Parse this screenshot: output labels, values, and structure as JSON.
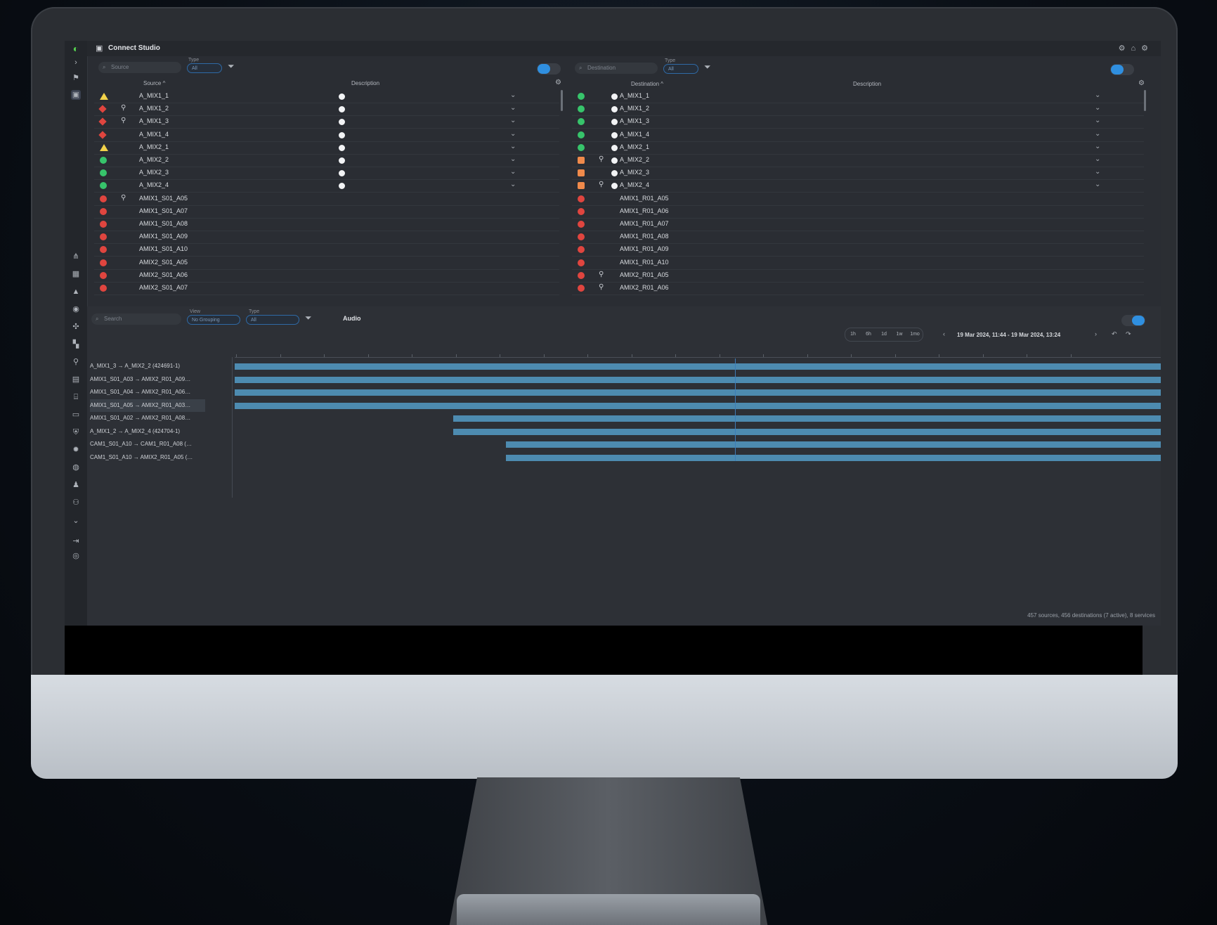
{
  "app": {
    "title": "Connect Studio"
  },
  "source_panel": {
    "search_placeholder": "Source",
    "type_label": "Type",
    "type_value": "All",
    "col_source": "Source ^",
    "col_description": "Description",
    "rows": [
      {
        "status": "warn",
        "pin": false,
        "name": "A_MIX1_1",
        "dot": true
      },
      {
        "status": "redd",
        "pin": true,
        "name": "A_MIX1_2",
        "dot": true
      },
      {
        "status": "redd",
        "pin": true,
        "name": "A_MIX1_3",
        "dot": true
      },
      {
        "status": "redd",
        "pin": false,
        "name": "A_MIX1_4",
        "dot": true
      },
      {
        "status": "warn",
        "pin": false,
        "name": "A_MIX2_1",
        "dot": true
      },
      {
        "status": "green",
        "pin": false,
        "name": "A_MIX2_2",
        "dot": true
      },
      {
        "status": "green",
        "pin": false,
        "name": "A_MIX2_3",
        "dot": true
      },
      {
        "status": "green",
        "pin": false,
        "name": "A_MIX2_4",
        "dot": true
      },
      {
        "status": "red",
        "pin": true,
        "name": "AMIX1_S01_A05",
        "dot": false
      },
      {
        "status": "red",
        "pin": false,
        "name": "AMIX1_S01_A07",
        "dot": false
      },
      {
        "status": "red",
        "pin": false,
        "name": "AMIX1_S01_A08",
        "dot": false
      },
      {
        "status": "red",
        "pin": false,
        "name": "AMIX1_S01_A09",
        "dot": false
      },
      {
        "status": "red",
        "pin": false,
        "name": "AMIX1_S01_A10",
        "dot": false
      },
      {
        "status": "red",
        "pin": false,
        "name": "AMIX2_S01_A05",
        "dot": false
      },
      {
        "status": "red",
        "pin": false,
        "name": "AMIX2_S01_A06",
        "dot": false
      },
      {
        "status": "red",
        "pin": false,
        "name": "AMIX2_S01_A07",
        "dot": false
      }
    ]
  },
  "destination_panel": {
    "search_placeholder": "Destination",
    "type_label": "Type",
    "type_value": "All",
    "col_destination": "Destination ^",
    "col_description": "Description",
    "rows": [
      {
        "status": "green",
        "pin": false,
        "name": "A_MIX1_1",
        "dot": true
      },
      {
        "status": "green",
        "pin": false,
        "name": "A_MIX1_2",
        "dot": true
      },
      {
        "status": "green",
        "pin": false,
        "name": "A_MIX1_3",
        "dot": true
      },
      {
        "status": "green",
        "pin": false,
        "name": "A_MIX1_4",
        "dot": true
      },
      {
        "status": "green",
        "pin": false,
        "name": "A_MIX2_1",
        "dot": true
      },
      {
        "status": "orange",
        "pin": true,
        "name": "A_MIX2_2",
        "dot": true
      },
      {
        "status": "orange",
        "pin": false,
        "name": "A_MIX2_3",
        "dot": true
      },
      {
        "status": "orange",
        "pin": true,
        "name": "A_MIX2_4",
        "dot": true
      },
      {
        "status": "red",
        "pin": false,
        "name": "AMIX1_R01_A05",
        "dot": false
      },
      {
        "status": "red",
        "pin": false,
        "name": "AMIX1_R01_A06",
        "dot": false
      },
      {
        "status": "red",
        "pin": false,
        "name": "AMIX1_R01_A07",
        "dot": false
      },
      {
        "status": "red",
        "pin": false,
        "name": "AMIX1_R01_A08",
        "dot": false
      },
      {
        "status": "red",
        "pin": false,
        "name": "AMIX1_R01_A09",
        "dot": false
      },
      {
        "status": "red",
        "pin": false,
        "name": "AMIX1_R01_A10",
        "dot": false
      },
      {
        "status": "red",
        "pin": true,
        "name": "AMIX2_R01_A05",
        "dot": false
      },
      {
        "status": "red",
        "pin": true,
        "name": "AMIX2_R01_A06",
        "dot": false
      }
    ]
  },
  "timeline": {
    "search_placeholder": "Search",
    "view_label": "View",
    "view_value": "No Grouping",
    "type_label": "Type",
    "type_value": "All",
    "audio_label": "Audio",
    "ranges": [
      "1h",
      "6h",
      "1d",
      "1w",
      "1mo"
    ],
    "date_range": "19 Mar 2024, 11:44 - 19 Mar 2024, 13:24",
    "rows": [
      {
        "label": "A_MIX1_3 → A_MIX2_2 (424691-1)",
        "start": 0.0,
        "end": 1.0
      },
      {
        "label": "AMIX1_S01_A03 → AMIX2_R01_A09…",
        "start": 0.0,
        "end": 1.0
      },
      {
        "label": "AMIX1_S01_A04 → AMIX2_R01_A06…",
        "start": 0.0,
        "end": 1.0
      },
      {
        "label": "AMIX1_S01_A05 → AMIX2_R01_A03…",
        "start": 0.0,
        "end": 1.0
      },
      {
        "label": "AMIX1_S01_A02 → AMIX2_R01_A08…",
        "start": 0.236,
        "end": 1.0
      },
      {
        "label": "A_MIX1_2 → A_MIX2_4 (424704-1)",
        "start": 0.236,
        "end": 1.0
      },
      {
        "label": "CAM1_S01_A10 → CAM1_R01_A08 (…",
        "start": 0.293,
        "end": 1.0
      },
      {
        "label": "CAM1_S01_A10 → AMIX2_R01_A05 (…",
        "start": 0.293,
        "end": 1.0
      }
    ],
    "cursor": 0.54
  },
  "status_text": "457 sources, 456 destinations (7 active), 8 services",
  "colors": {
    "accent": "#2f8fe0",
    "bar": "#4d8bb0",
    "green": "#37c46b",
    "red": "#e0453f",
    "orange": "#f08a4b",
    "warn": "#f2d24a"
  }
}
